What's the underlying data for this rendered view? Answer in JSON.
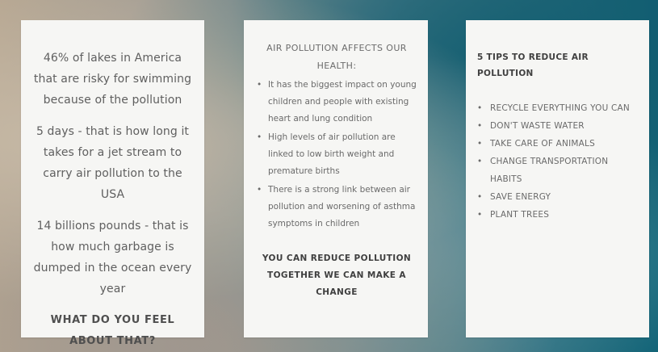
{
  "card1": {
    "stats": [
      "46% of lakes in America that are risky for swimming because of the pollution",
      "5 days - that is how long it takes for a jet stream to carry air pollution to the USA",
      "14 billions pounds - that is how much garbage is dumped in the ocean every year"
    ],
    "cta": "WHAT DO YOU FEEL ABOUT THAT?"
  },
  "card2": {
    "heading": "AIR POLLUTION AFFECTS OUR HEALTH:",
    "bullets": [
      "It has the biggest impact on young children and people with existing heart and lung condition",
      "High levels of air pollution are linked to low birth weight and premature births",
      "There is a strong link between air pollution and worsening of asthma symptoms in children"
    ],
    "cta": "YOU CAN REDUCE POLLUTION TOGETHER WE CAN MAKE A CHANGE"
  },
  "card3": {
    "heading": "5 TIPS TO REDUCE AIR POLLUTION",
    "tips": [
      "RECYCLE EVERYTHING YOU CAN",
      "DON'T WASTE WATER",
      "TAKE CARE OF ANIMALS",
      "CHANGE TRANSPORTATION HABITS",
      "SAVE ENERGY",
      "PLANT TREES"
    ]
  }
}
